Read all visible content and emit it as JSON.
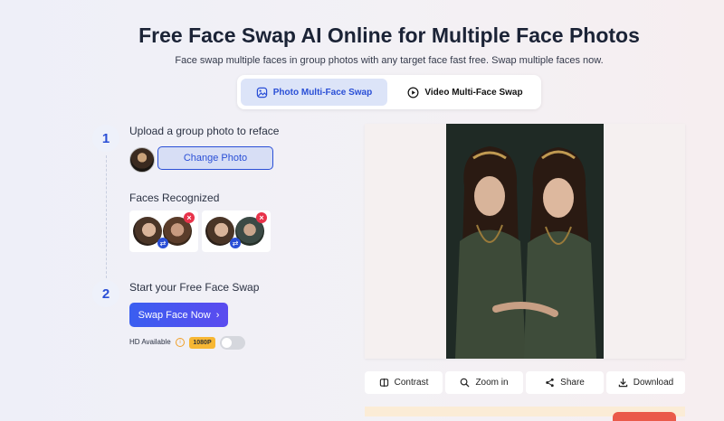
{
  "header": {
    "title": "Free Face Swap AI Online for Multiple Face Photos",
    "subtitle": "Face swap multiple faces in group photos with any target face fast free. Swap multiple faces now."
  },
  "tabs": [
    {
      "label": "Photo Multi-Face Swap",
      "active": true,
      "icon": "image-icon"
    },
    {
      "label": "Video Multi-Face Swap",
      "active": false,
      "icon": "play-circle-icon"
    }
  ],
  "step1": {
    "number": "1",
    "label": "Upload a group photo to reface",
    "change_button": "Change Photo",
    "faces_label": "Faces Recognized"
  },
  "step2": {
    "number": "2",
    "label": "Start your Free Face Swap",
    "swap_button": "Swap Face Now",
    "swap_chevron": "›",
    "hd_label": "HD Available",
    "info_glyph": "i",
    "hd_badge": "1080P",
    "hd_enabled": false
  },
  "badges": {
    "swap_glyph": "⇄",
    "delete_glyph": "×"
  },
  "toolbar": {
    "contrast": "Contrast",
    "zoom": "Zoom in",
    "share": "Share",
    "download": "Download"
  },
  "colors": {
    "accent": "#2a4fd6",
    "delete": "#e8334a",
    "hd_badge": "#f7b733"
  }
}
